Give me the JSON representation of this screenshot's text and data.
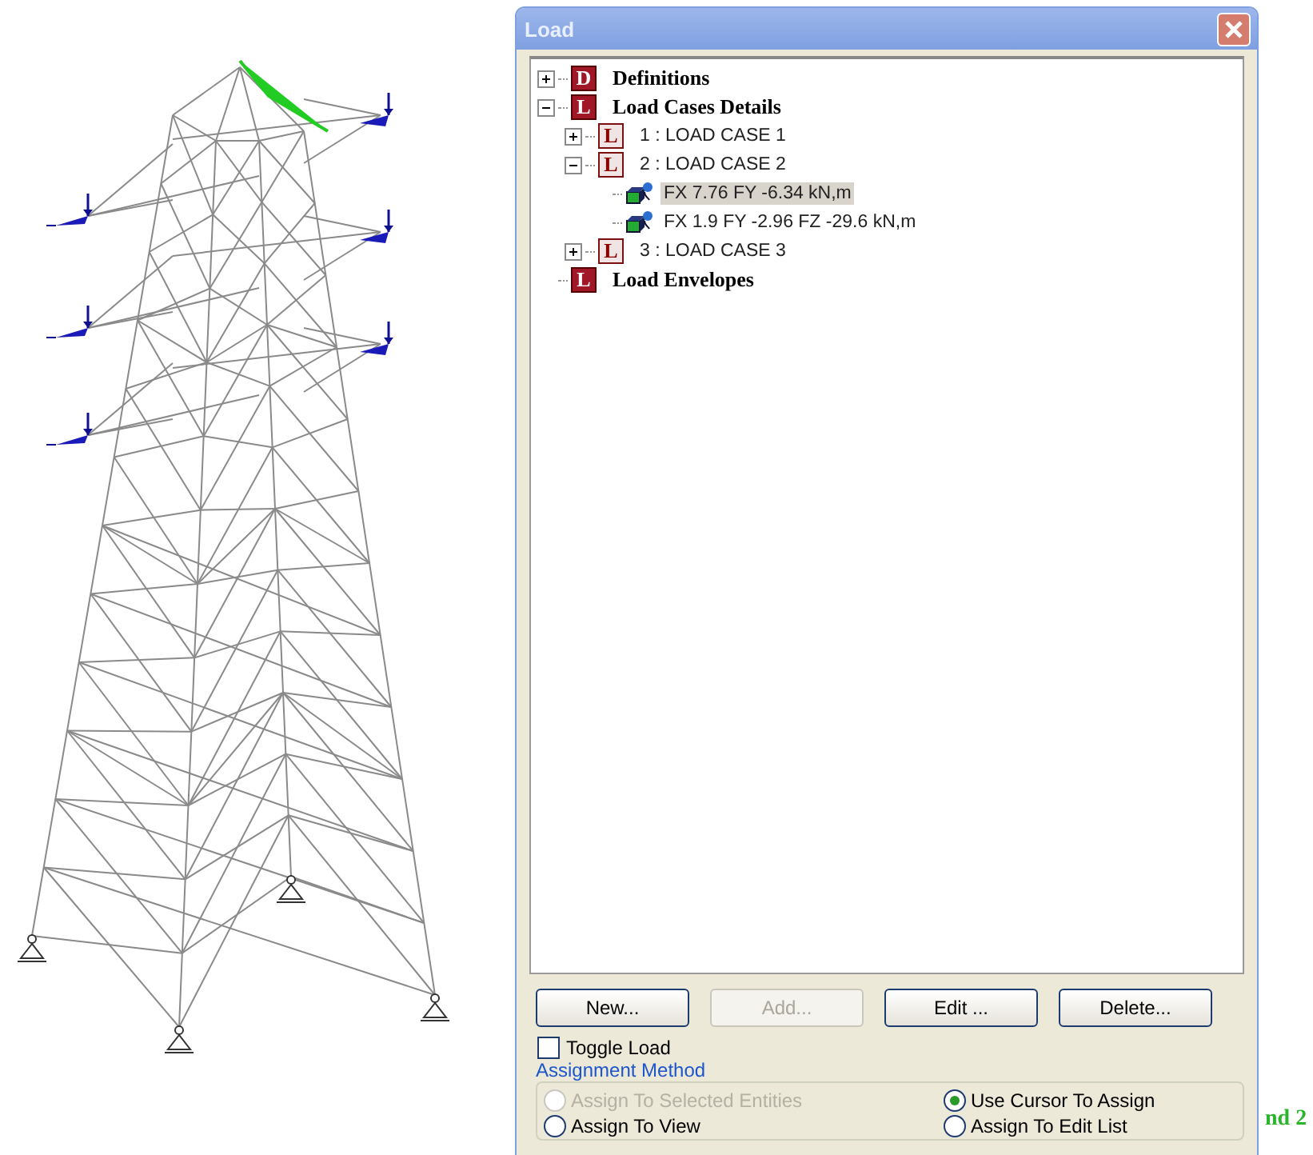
{
  "model_view": {
    "label_fragment": "nd 2"
  },
  "dialog": {
    "title": "Load",
    "tree": [
      {
        "badge": "D",
        "kind": "group",
        "label": "Definitions",
        "expanded": false,
        "selected": false
      },
      {
        "badge": "L",
        "kind": "group",
        "label": "Load Cases Details",
        "expanded": true,
        "selected": false,
        "children": [
          {
            "badge": "L",
            "kind": "case",
            "label": "1 : LOAD CASE 1",
            "expanded": false,
            "selected": false
          },
          {
            "badge": "L",
            "kind": "case",
            "label": "2 : LOAD CASE 2",
            "expanded": true,
            "selected": false,
            "children": [
              {
                "kind": "node-load",
                "label": "FX 7.76 FY -6.34 kN,m",
                "selected": true
              },
              {
                "kind": "node-load",
                "label": "FX 1.9 FY -2.96 FZ -29.6 kN,m",
                "selected": false
              }
            ]
          },
          {
            "badge": "L",
            "kind": "case",
            "label": "3 : LOAD CASE 3",
            "expanded": false,
            "selected": false
          }
        ]
      },
      {
        "badge": "L",
        "kind": "leaf-group",
        "label": "Load Envelopes",
        "selected": false
      }
    ],
    "buttons": [
      {
        "label": "New...",
        "disabled": false
      },
      {
        "label": "Add...",
        "disabled": true
      },
      {
        "label": "Edit ...",
        "disabled": false
      },
      {
        "label": "Delete...",
        "disabled": false
      }
    ],
    "toggle": {
      "label": "Toggle Load",
      "checked": false
    },
    "assignment": {
      "legend": "Assignment Method",
      "options": [
        {
          "label": "Assign To Selected Entities",
          "selected": false,
          "disabled": true
        },
        {
          "label": "Use Cursor To Assign",
          "selected": true,
          "disabled": false
        },
        {
          "label": "Assign To View",
          "selected": false,
          "disabled": false
        },
        {
          "label": "Assign To Edit List",
          "selected": false,
          "disabled": false
        }
      ]
    }
  }
}
